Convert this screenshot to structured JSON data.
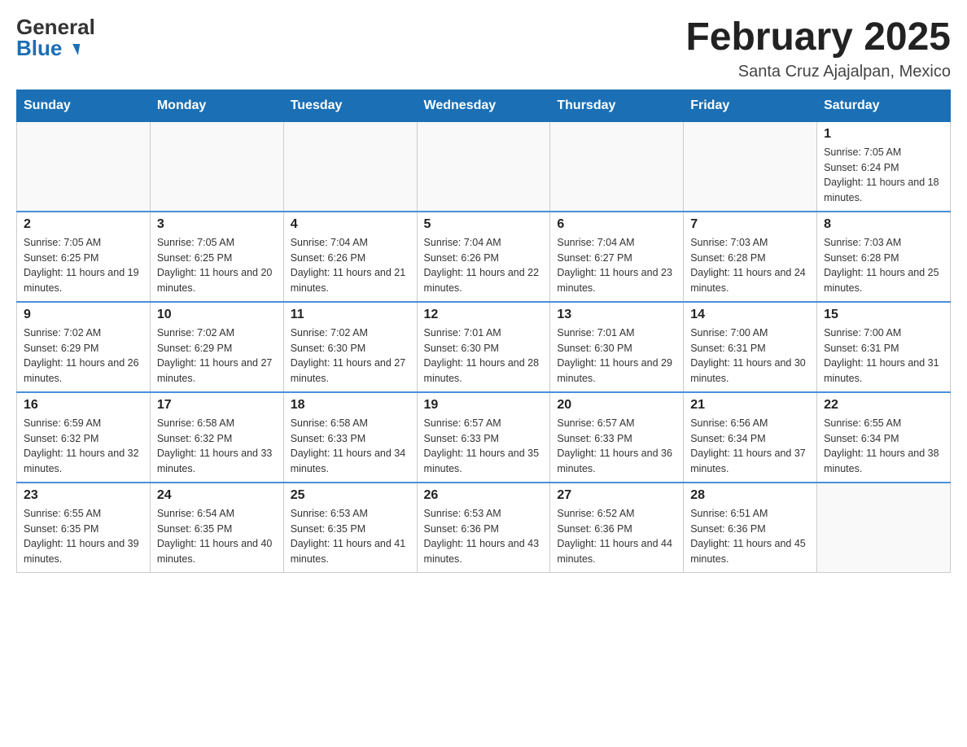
{
  "logo": {
    "line1": "General",
    "line2": "Blue"
  },
  "title": {
    "month_year": "February 2025",
    "location": "Santa Cruz Ajajalpan, Mexico"
  },
  "days_of_week": [
    "Sunday",
    "Monday",
    "Tuesday",
    "Wednesday",
    "Thursday",
    "Friday",
    "Saturday"
  ],
  "weeks": [
    {
      "days": [
        {
          "num": "",
          "info": ""
        },
        {
          "num": "",
          "info": ""
        },
        {
          "num": "",
          "info": ""
        },
        {
          "num": "",
          "info": ""
        },
        {
          "num": "",
          "info": ""
        },
        {
          "num": "",
          "info": ""
        },
        {
          "num": "1",
          "info": "Sunrise: 7:05 AM\nSunset: 6:24 PM\nDaylight: 11 hours and 18 minutes."
        }
      ]
    },
    {
      "days": [
        {
          "num": "2",
          "info": "Sunrise: 7:05 AM\nSunset: 6:25 PM\nDaylight: 11 hours and 19 minutes."
        },
        {
          "num": "3",
          "info": "Sunrise: 7:05 AM\nSunset: 6:25 PM\nDaylight: 11 hours and 20 minutes."
        },
        {
          "num": "4",
          "info": "Sunrise: 7:04 AM\nSunset: 6:26 PM\nDaylight: 11 hours and 21 minutes."
        },
        {
          "num": "5",
          "info": "Sunrise: 7:04 AM\nSunset: 6:26 PM\nDaylight: 11 hours and 22 minutes."
        },
        {
          "num": "6",
          "info": "Sunrise: 7:04 AM\nSunset: 6:27 PM\nDaylight: 11 hours and 23 minutes."
        },
        {
          "num": "7",
          "info": "Sunrise: 7:03 AM\nSunset: 6:28 PM\nDaylight: 11 hours and 24 minutes."
        },
        {
          "num": "8",
          "info": "Sunrise: 7:03 AM\nSunset: 6:28 PM\nDaylight: 11 hours and 25 minutes."
        }
      ]
    },
    {
      "days": [
        {
          "num": "9",
          "info": "Sunrise: 7:02 AM\nSunset: 6:29 PM\nDaylight: 11 hours and 26 minutes."
        },
        {
          "num": "10",
          "info": "Sunrise: 7:02 AM\nSunset: 6:29 PM\nDaylight: 11 hours and 27 minutes."
        },
        {
          "num": "11",
          "info": "Sunrise: 7:02 AM\nSunset: 6:30 PM\nDaylight: 11 hours and 27 minutes."
        },
        {
          "num": "12",
          "info": "Sunrise: 7:01 AM\nSunset: 6:30 PM\nDaylight: 11 hours and 28 minutes."
        },
        {
          "num": "13",
          "info": "Sunrise: 7:01 AM\nSunset: 6:30 PM\nDaylight: 11 hours and 29 minutes."
        },
        {
          "num": "14",
          "info": "Sunrise: 7:00 AM\nSunset: 6:31 PM\nDaylight: 11 hours and 30 minutes."
        },
        {
          "num": "15",
          "info": "Sunrise: 7:00 AM\nSunset: 6:31 PM\nDaylight: 11 hours and 31 minutes."
        }
      ]
    },
    {
      "days": [
        {
          "num": "16",
          "info": "Sunrise: 6:59 AM\nSunset: 6:32 PM\nDaylight: 11 hours and 32 minutes."
        },
        {
          "num": "17",
          "info": "Sunrise: 6:58 AM\nSunset: 6:32 PM\nDaylight: 11 hours and 33 minutes."
        },
        {
          "num": "18",
          "info": "Sunrise: 6:58 AM\nSunset: 6:33 PM\nDaylight: 11 hours and 34 minutes."
        },
        {
          "num": "19",
          "info": "Sunrise: 6:57 AM\nSunset: 6:33 PM\nDaylight: 11 hours and 35 minutes."
        },
        {
          "num": "20",
          "info": "Sunrise: 6:57 AM\nSunset: 6:33 PM\nDaylight: 11 hours and 36 minutes."
        },
        {
          "num": "21",
          "info": "Sunrise: 6:56 AM\nSunset: 6:34 PM\nDaylight: 11 hours and 37 minutes."
        },
        {
          "num": "22",
          "info": "Sunrise: 6:55 AM\nSunset: 6:34 PM\nDaylight: 11 hours and 38 minutes."
        }
      ]
    },
    {
      "days": [
        {
          "num": "23",
          "info": "Sunrise: 6:55 AM\nSunset: 6:35 PM\nDaylight: 11 hours and 39 minutes."
        },
        {
          "num": "24",
          "info": "Sunrise: 6:54 AM\nSunset: 6:35 PM\nDaylight: 11 hours and 40 minutes."
        },
        {
          "num": "25",
          "info": "Sunrise: 6:53 AM\nSunset: 6:35 PM\nDaylight: 11 hours and 41 minutes."
        },
        {
          "num": "26",
          "info": "Sunrise: 6:53 AM\nSunset: 6:36 PM\nDaylight: 11 hours and 43 minutes."
        },
        {
          "num": "27",
          "info": "Sunrise: 6:52 AM\nSunset: 6:36 PM\nDaylight: 11 hours and 44 minutes."
        },
        {
          "num": "28",
          "info": "Sunrise: 6:51 AM\nSunset: 6:36 PM\nDaylight: 11 hours and 45 minutes."
        },
        {
          "num": "",
          "info": ""
        }
      ]
    }
  ]
}
